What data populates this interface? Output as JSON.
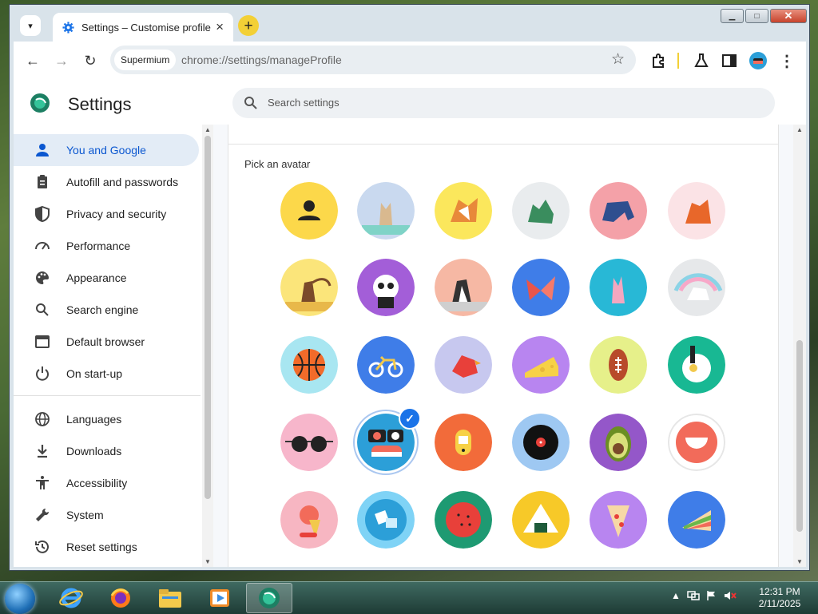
{
  "browser": {
    "tab_search_icon": "chevron-down-icon",
    "tab": {
      "title": "Settings – Customise profile",
      "favicon": "gear-icon",
      "close": "×"
    },
    "new_tab_label": "+",
    "window_controls": {
      "minimize": "▁",
      "maximize": "□",
      "close": "✕"
    },
    "nav": {
      "back": "←",
      "forward": "→",
      "reload": "↻"
    },
    "omnibox": {
      "chip": "Supermium",
      "url": "chrome://settings/manageProfile",
      "bookmark": "☆"
    },
    "toolbar_icons": [
      "extensions-icon",
      "labs-icon",
      "side-panel-icon",
      "profile-avatar",
      "menu-icon"
    ]
  },
  "settings": {
    "title": "Settings",
    "search_placeholder": "Search settings",
    "nav_items": [
      {
        "label": "You and Google",
        "icon": "person-icon",
        "active": true
      },
      {
        "label": "Autofill and passwords",
        "icon": "clipboard-icon"
      },
      {
        "label": "Privacy and security",
        "icon": "shield-icon"
      },
      {
        "label": "Performance",
        "icon": "speedometer-icon"
      },
      {
        "label": "Appearance",
        "icon": "palette-icon"
      },
      {
        "label": "Search engine",
        "icon": "search-icon"
      },
      {
        "label": "Default browser",
        "icon": "browser-window-icon"
      },
      {
        "label": "On start-up",
        "icon": "power-icon"
      },
      {
        "label": "Languages",
        "icon": "globe-icon"
      },
      {
        "label": "Downloads",
        "icon": "download-icon"
      },
      {
        "label": "Accessibility",
        "icon": "accessibility-icon"
      },
      {
        "label": "System",
        "icon": "wrench-icon"
      },
      {
        "label": "Reset settings",
        "icon": "history-icon"
      }
    ],
    "pick_avatar_label": "Pick an avatar",
    "avatars": [
      {
        "name": "generic-person",
        "bg": "#fcd84a"
      },
      {
        "name": "cat",
        "bg": "#c9d9ef"
      },
      {
        "name": "corgi",
        "bg": "#fbe75c"
      },
      {
        "name": "dragon",
        "bg": "#e9ecee"
      },
      {
        "name": "elephant",
        "bg": "#f4a1a8"
      },
      {
        "name": "fox",
        "bg": "#fbe3e6"
      },
      {
        "name": "monkey",
        "bg": "#fbe57a"
      },
      {
        "name": "panda",
        "bg": "#a35ed8"
      },
      {
        "name": "penguin",
        "bg": "#f6b8a4"
      },
      {
        "name": "butterfly",
        "bg": "#3f7de8"
      },
      {
        "name": "rabbit",
        "bg": "#28b8d6"
      },
      {
        "name": "unicorn",
        "bg": "#e6e8ea"
      },
      {
        "name": "basketball",
        "bg": "#a8e6f1"
      },
      {
        "name": "bicycle",
        "bg": "#3f7de8"
      },
      {
        "name": "bird",
        "bg": "#c7c8ef"
      },
      {
        "name": "cheese",
        "bg": "#b885f0"
      },
      {
        "name": "football",
        "bg": "#e6f08a"
      },
      {
        "name": "ramen",
        "bg": "#18b893"
      },
      {
        "name": "sunglasses",
        "bg": "#f7b6cb"
      },
      {
        "name": "sushi",
        "bg": "#2c9fd8",
        "selected": true
      },
      {
        "name": "tamagotchi",
        "bg": "#f26b3a"
      },
      {
        "name": "vinyl",
        "bg": "#9ec8f2"
      },
      {
        "name": "avocado",
        "bg": "#9457c9"
      },
      {
        "name": "smile",
        "bg": "#ffffff"
      },
      {
        "name": "ice-cream",
        "bg": "#f7b6c2"
      },
      {
        "name": "blocks",
        "bg": "#7fd3f6"
      },
      {
        "name": "watermelon",
        "bg": "#1e9a72"
      },
      {
        "name": "onigiri",
        "bg": "#f7c928"
      },
      {
        "name": "pizza",
        "bg": "#b885f0"
      },
      {
        "name": "sandwich",
        "bg": "#3f7de8"
      }
    ]
  },
  "taskbar": {
    "apps": [
      "start-orb",
      "internet-explorer-icon",
      "firefox-icon",
      "file-explorer-icon",
      "media-player-icon",
      "supermium-icon"
    ],
    "tray_up": "▲",
    "time": "12:31 PM",
    "date": "2/11/2025"
  }
}
